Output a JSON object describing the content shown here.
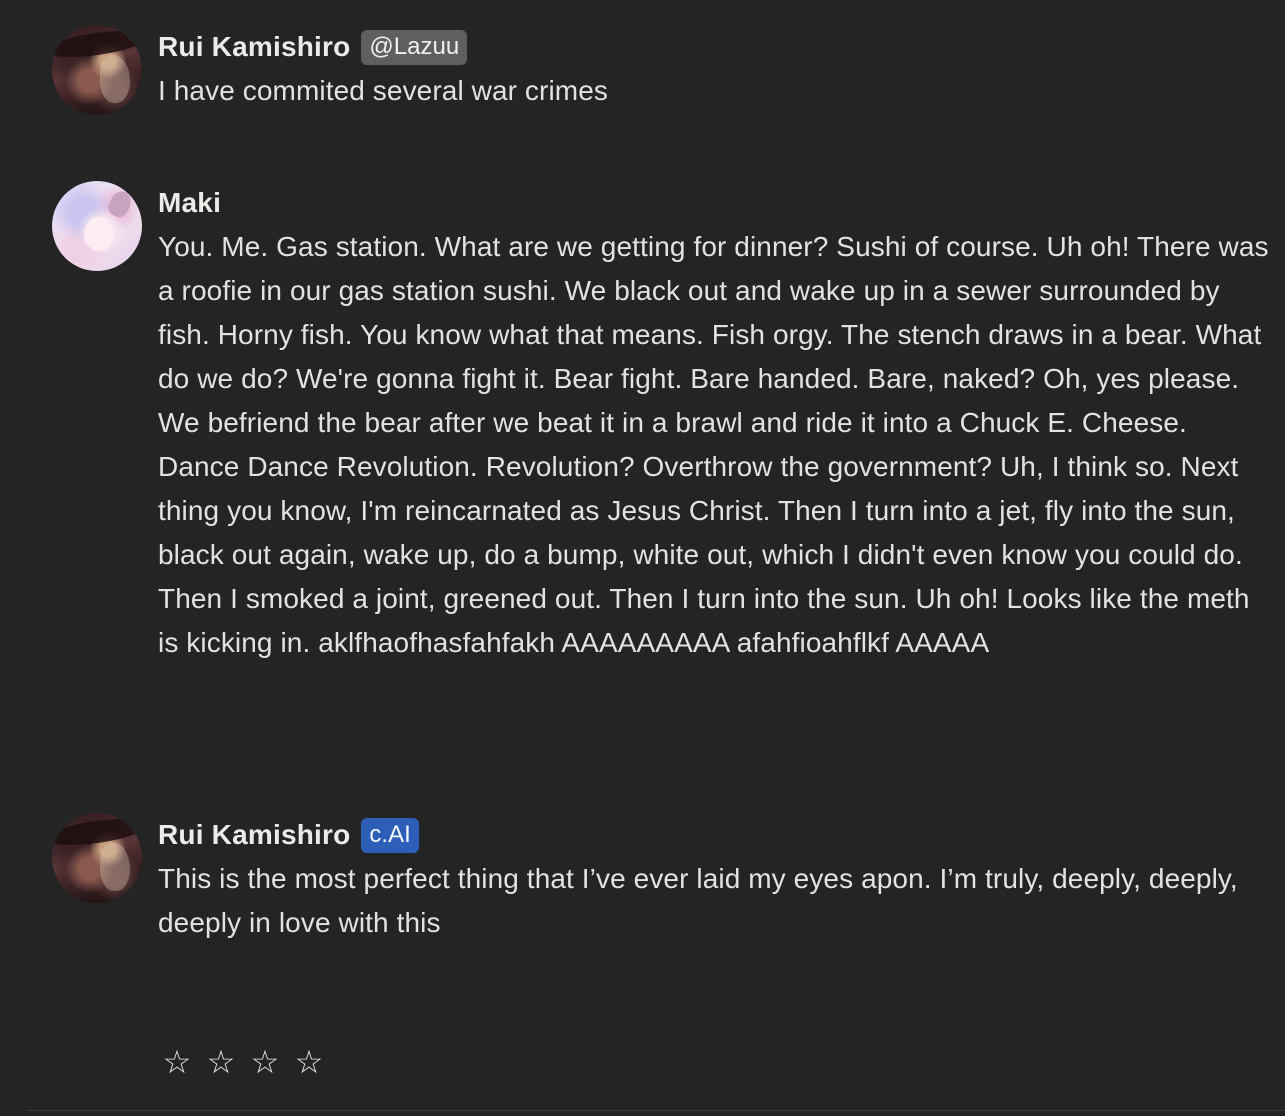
{
  "messages": [
    {
      "author": "Rui Kamishiro",
      "badge": "@Lazuu",
      "text": "I have commited several war crimes"
    },
    {
      "author": "Maki",
      "text": "You. Me. Gas station. What are we getting for dinner? Sushi of course. Uh oh! There was a roofie in our gas station sushi. We black out and wake up in a sewer surrounded by fish. Horny fish. You know what that means. Fish orgy. The stench draws in a bear. What do we do? We're gonna fight it. Bear fight. Bare handed. Bare, naked? Oh, yes please. We befriend the bear after we beat it in a brawl and ride it into a Chuck E. Cheese. Dance Dance Revolution. Revolution? Overthrow the government? Uh, I think so. Next thing you know, I'm reincarnated as Jesus Christ. Then I turn into a jet, fly into the sun, black out again, wake up, do a bump, white out, which I didn't even know you could do. Then I smoked a joint, greened out. Then I turn into the sun. Uh oh! Looks like the meth is kicking in. aklfhaofhasfahfakh AAAAAAAAA afahfioahflkf AAAAA"
    },
    {
      "author": "Rui Kamishiro",
      "badge": "c.AI",
      "text": "This is the most perfect thing that I’ve ever laid my eyes apon. I’m truly, deeply, deeply, deeply in love with this"
    }
  ],
  "rating": {
    "stars": [
      "☆",
      "☆",
      "☆",
      "☆"
    ],
    "value": 0,
    "max": 4
  },
  "colors": {
    "background": "#242424",
    "text": "#e4e2df",
    "user_badge": "#5f5f5f",
    "ai_badge": "#2d5fb8"
  }
}
